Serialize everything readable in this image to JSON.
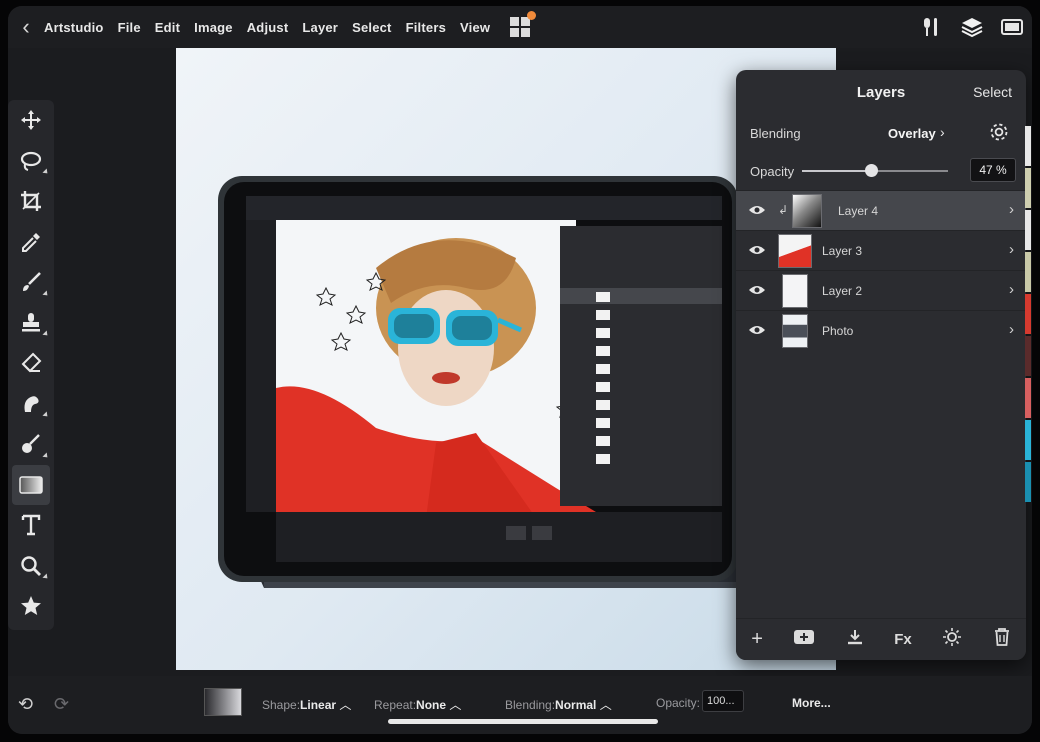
{
  "app": {
    "name": "Artstudio",
    "menu": [
      "File",
      "Edit",
      "Image",
      "Adjust",
      "Layer",
      "Select",
      "Filters",
      "View"
    ]
  },
  "toolbar": {
    "tools": [
      "move",
      "lasso",
      "crop",
      "eyedropper",
      "brush",
      "stamp",
      "eraser",
      "smudge",
      "fill",
      "gradient",
      "text",
      "zoom",
      "favorites"
    ],
    "active": "gradient"
  },
  "layers_panel": {
    "title": "Layers",
    "select_label": "Select",
    "blending_label": "Blending",
    "blending_value": "Overlay",
    "opacity_label": "Opacity",
    "opacity_value": "47 %",
    "opacity_fraction": 0.47,
    "layers": [
      {
        "name": "Layer 4",
        "selected": true,
        "clipped": true
      },
      {
        "name": "Layer 3",
        "selected": false,
        "clipped": false
      },
      {
        "name": "Layer 2",
        "selected": false,
        "clipped": false
      },
      {
        "name": "Photo",
        "selected": false,
        "clipped": false
      }
    ],
    "footer": {
      "add": "+",
      "fx": "Fx"
    }
  },
  "options_bar": {
    "shape_label": "Shape:",
    "shape_value": "Linear",
    "repeat_label": "Repeat:",
    "repeat_value": "None",
    "blending_label": "Blending:",
    "blending_value": "Normal",
    "opacity_label": "Opacity:",
    "opacity_value": "100...",
    "more_label": "More..."
  },
  "colors": {
    "accent_orange": "#f08a3a",
    "panel_bg": "#2b2c30",
    "selected_row": "#45474c",
    "artwork_red": "#e03226",
    "sunglasses_cyan": "#2ab4d8"
  }
}
